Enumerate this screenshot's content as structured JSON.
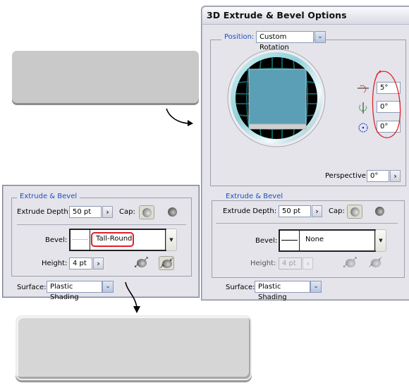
{
  "dialog": {
    "title": "3D Extrude & Bevel Options",
    "position": {
      "label": "Position:",
      "value": "Custom Rotation"
    },
    "rotation": {
      "x_axis": "5°",
      "y_axis": "0°",
      "z_axis": "0°"
    },
    "perspective": {
      "label": "Perspective:",
      "value": "0°"
    },
    "extrude_bevel": {
      "legend": "Extrude & Bevel",
      "extrude_depth_label": "Extrude Depth:",
      "extrude_depth_value": "50 pt",
      "cap_label": "Cap:",
      "bevel_label": "Bevel:",
      "bevel_value": "None",
      "height_label": "Height:",
      "height_value": "4 pt"
    },
    "surface": {
      "label": "Surface:",
      "value": "Plastic Shading"
    }
  },
  "left_panel": {
    "extrude_bevel": {
      "legend": "Extrude & Bevel",
      "extrude_depth_label": "Extrude Depth:",
      "extrude_depth_value": "50 pt",
      "cap_label": "Cap:",
      "bevel_label": "Bevel:",
      "bevel_value": "Tall-Round",
      "height_label": "Height:",
      "height_value": "4 pt"
    },
    "surface": {
      "label": "Surface:",
      "value": "Plastic Shading"
    }
  },
  "colors": {
    "annotation_red": "#e0202a",
    "preview_face": "#5b9fb6",
    "grid_teal": "#0e6a70",
    "legend_blue": "#1d4fc4"
  }
}
